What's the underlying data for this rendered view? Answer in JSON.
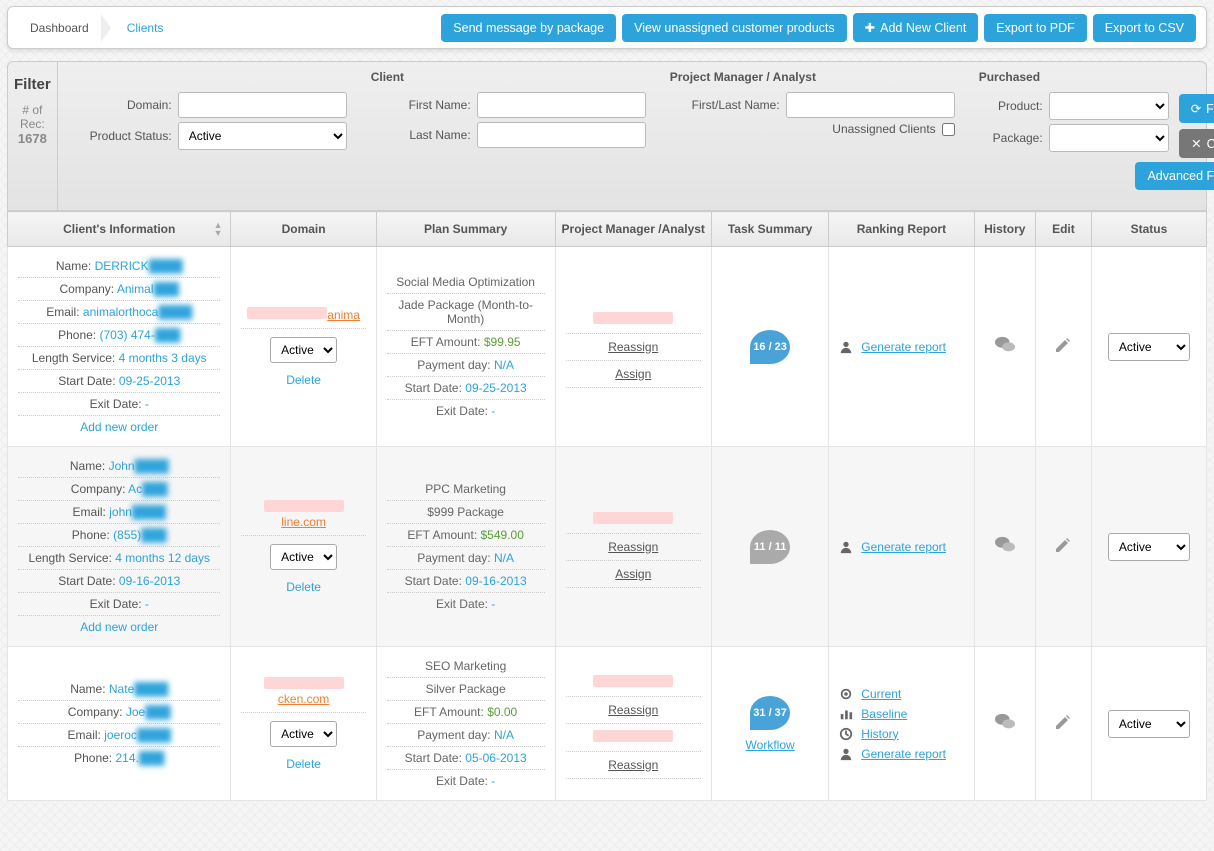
{
  "breadcrumb": {
    "dashboard": "Dashboard",
    "clients": "Clients"
  },
  "topbuttons": {
    "send_pkg": "Send message by package",
    "view_unassigned": "View unassigned customer products",
    "add_client": "Add New Client",
    "export_pdf": "Export to PDF",
    "export_csv": "Export to CSV"
  },
  "filter": {
    "title": "Filter",
    "rec_label": "# of Rec:",
    "rec_value": "1678",
    "domain_label": "Domain:",
    "product_status_label": "Product Status:",
    "product_status_value": "Active",
    "client_header": "Client",
    "first_name_label": "First Name:",
    "last_name_label": "Last Name:",
    "pm_header": "Project Manager / Analyst",
    "pm_name_label": "First/Last Name:",
    "unassigned_label": "Unassigned Clients",
    "purchased_header": "Purchased",
    "product_label": "Product:",
    "package_label": "Package:",
    "filter_btn": "FILTER",
    "clear_btn": "CLEAR",
    "advanced_btn": "Advanced Filter"
  },
  "columns": {
    "client_info": "Client's Information",
    "domain": "Domain",
    "plan": "Plan Summary",
    "pm": "Project Manager /Analyst",
    "task": "Task Summary",
    "ranking": "Ranking Report",
    "history": "History",
    "edit": "Edit",
    "status": "Status"
  },
  "labels": {
    "name": "Name:",
    "company": "Company:",
    "email": "Email:",
    "phone": "Phone:",
    "length": "Length Service:",
    "start": "Start Date:",
    "exit": "Exit Date:",
    "add_order": "Add new order",
    "delete": "Delete",
    "eft": "EFT Amount:",
    "payday": "Payment day:",
    "reassign": "Reassign",
    "assign": "Assign",
    "gen_report": "Generate report",
    "current": "Current",
    "baseline": "Baseline",
    "history": "History",
    "workflow": "Workflow",
    "status_active": "Active"
  },
  "rows": [
    {
      "name": "DERRICK",
      "company": "Animal",
      "email": "animalorthoca",
      "phone": "(703) 474-",
      "length": "4 months 3 days",
      "start": "09-25-2013",
      "exit": "-",
      "domain": "anima",
      "plan_title": "Social Media Optimization",
      "plan_pkg": "Jade Package (Month-to-Month)",
      "eft": "$99.95",
      "payday": "N/A",
      "pstart": "09-25-2013",
      "pexit": "-",
      "task": "16 / 23",
      "task_color": "blue",
      "rr_mode": "simple"
    },
    {
      "name": "John",
      "company": "Ac",
      "email": "john",
      "phone": "(855)",
      "length": "4 months 12 days",
      "start": "09-16-2013",
      "exit": "-",
      "domain": "line.com",
      "plan_title": "PPC Marketing",
      "plan_pkg": "$999 Package",
      "eft": "$549.00",
      "payday": "N/A",
      "pstart": "09-16-2013",
      "pexit": "-",
      "task": "11 / 11",
      "task_color": "grey",
      "rr_mode": "simple"
    },
    {
      "name": "Nate",
      "company": "Joe",
      "email": "joeroc",
      "phone": "214.",
      "length": "",
      "start": "",
      "exit": "",
      "domain": "cken.com",
      "plan_title": "SEO Marketing",
      "plan_pkg": "Silver Package",
      "eft": "$0.00",
      "payday": "N/A",
      "pstart": "05-06-2013",
      "pexit": "-",
      "task": "31 / 37",
      "task_color": "blue",
      "workflow": "Workflow",
      "rr_mode": "full"
    }
  ]
}
